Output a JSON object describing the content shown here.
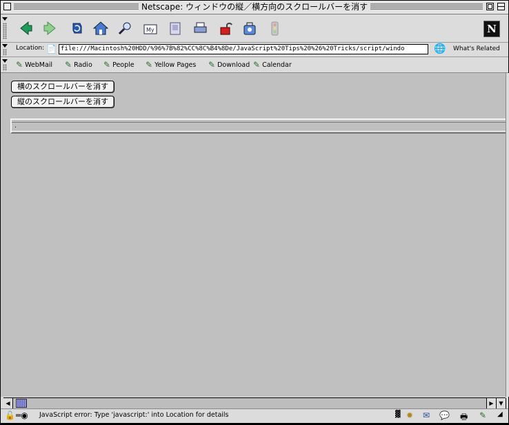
{
  "window": {
    "title": "Netscape: ウィンドウの縦／横方向のスクロールバーを消す"
  },
  "navigation_toolbar": {
    "buttons": [
      {
        "name": "back",
        "icon": "back-arrow-icon"
      },
      {
        "name": "forward",
        "icon": "forward-arrow-icon"
      },
      {
        "name": "reload",
        "icon": "reload-icon"
      },
      {
        "name": "home",
        "icon": "home-icon"
      },
      {
        "name": "search",
        "icon": "search-icon"
      },
      {
        "name": "my-netscape",
        "icon": "my-netscape-icon",
        "label": "My"
      },
      {
        "name": "images",
        "icon": "images-icon"
      },
      {
        "name": "print",
        "icon": "print-icon"
      },
      {
        "name": "security",
        "icon": "padlock-icon"
      },
      {
        "name": "shop",
        "icon": "shop-icon"
      },
      {
        "name": "stop",
        "icon": "stop-icon"
      }
    ],
    "logo": "N"
  },
  "location_bar": {
    "label": "Location:",
    "url": "file:///Macintosh%20HDD/%96%7B%82%CC%8C%B4%8De/JavaScript%20Tips%20%26%20Tricks/script/windo",
    "whats_related": "What's Related"
  },
  "personal_toolbar": {
    "items": [
      "WebMail",
      "Radio",
      "People",
      "Yellow Pages",
      "Download",
      "Calendar"
    ]
  },
  "content": {
    "buttons": [
      "横のスクロールバーを消す",
      "縦のスクロールバーを消す"
    ],
    "frame_text": "."
  },
  "status_bar": {
    "message": "JavaScript error: Type 'javascript:' into Location for details"
  },
  "colors": {
    "content_bg": "#c0c0c0",
    "chrome_bg": "#dcdcdc",
    "scroll_thumb": "#8f8fd0"
  }
}
